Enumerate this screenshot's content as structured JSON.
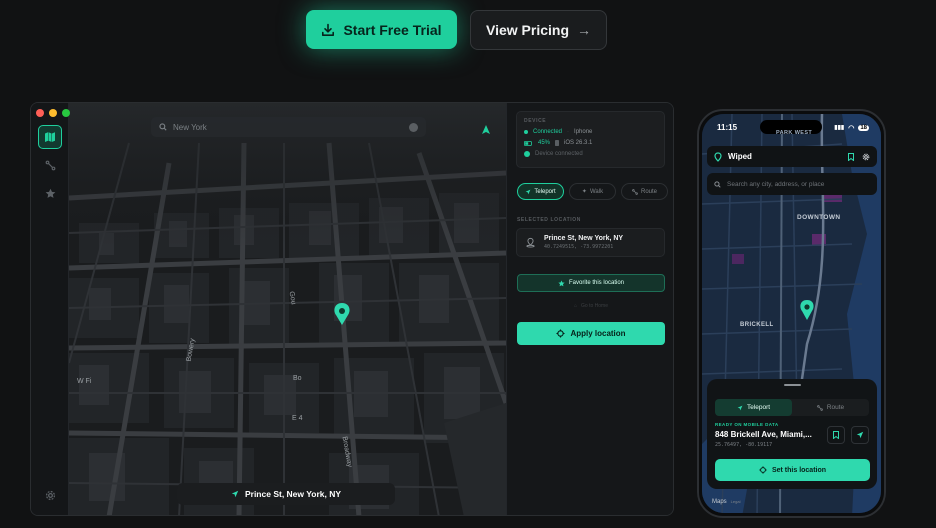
{
  "cta": {
    "trial_label": "Start Free Trial",
    "pricing_label": "View Pricing"
  },
  "desktop": {
    "search_placeholder": "New York",
    "map_labels": [
      "Broadway",
      "Bowery",
      "W Fi",
      "E 4",
      "Bo",
      "Bo",
      "Gou",
      "Bo"
    ],
    "location_pill": "Prince St, New York, NY",
    "panel": {
      "device_heading": "DEVICE",
      "connected_label": "Connected",
      "device_name": "Iphone",
      "battery": "45%",
      "ios_version": "iOS 26.3.1",
      "device_status": "Device connected",
      "modes": [
        {
          "label": "Teleport",
          "icon": "navigation-arrow-icon",
          "active": true
        },
        {
          "label": "Walk",
          "icon": "walk-icon",
          "active": false
        },
        {
          "label": "Route",
          "icon": "route-icon",
          "active": false
        }
      ],
      "selected_heading": "SELECTED LOCATION",
      "selected_name": "Prince St, New York, NY",
      "selected_coords": "40.7249515, -73.9972201",
      "favorite_label": "Favorite this location",
      "go_home_label": "Go to Home",
      "apply_label": "Apply location"
    }
  },
  "phone": {
    "time": "11:15",
    "battery": "18",
    "app_name": "Wiped",
    "search_placeholder": "Search any city, address, or place",
    "map_labels": {
      "park_west": "PARK WEST",
      "downtown": "DOWNTOWN",
      "brickell": "BRICKELL"
    },
    "tabs": [
      {
        "label": "Teleport",
        "active": true
      },
      {
        "label": "Route",
        "active": false
      }
    ],
    "ready_label": "READY ON MOBILE DATA",
    "address": "848 Brickell Ave, Miami,...",
    "coords": "25.76497, -80.19117",
    "set_label": "Set this location",
    "maps_credit": "Maps",
    "maps_legal": "Legal"
  },
  "colors": {
    "accent": "#1fcf9d",
    "accent_button": "#2fd9ae",
    "background": "#111213"
  }
}
